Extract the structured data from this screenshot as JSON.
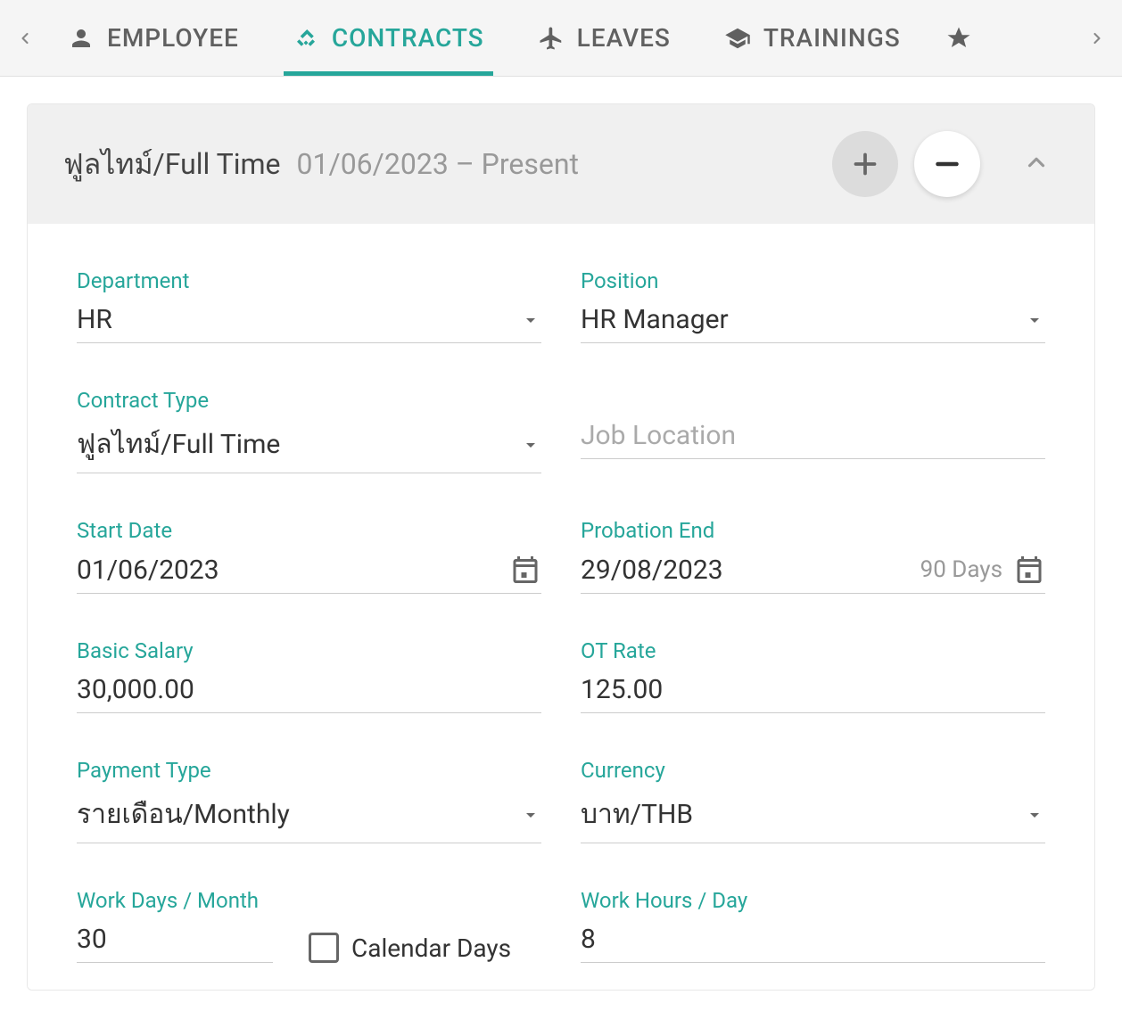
{
  "tabs": {
    "employee": "EMPLOYEE",
    "contracts": "CONTRACTS",
    "leaves": "LEAVES",
    "trainings": "TRAININGS"
  },
  "contract": {
    "title": "ฟูลไทม์/Full Time",
    "date_range": "01/06/2023 – Present",
    "fields": {
      "department": {
        "label": "Department",
        "value": "HR"
      },
      "position": {
        "label": "Position",
        "value": "HR Manager"
      },
      "contract_type": {
        "label": "Contract Type",
        "value": "ฟูลไทม์/Full Time"
      },
      "job_location": {
        "placeholder": "Job Location",
        "value": ""
      },
      "start_date": {
        "label": "Start Date",
        "value": "01/06/2023"
      },
      "probation_end": {
        "label": "Probation End",
        "value": "29/08/2023",
        "suffix": "90 Days"
      },
      "basic_salary": {
        "label": "Basic Salary",
        "value": "30,000.00"
      },
      "ot_rate": {
        "label": "OT Rate",
        "value": "125.00"
      },
      "payment_type": {
        "label": "Payment Type",
        "value": "รายเดือน/Monthly"
      },
      "currency": {
        "label": "Currency",
        "value": "บาท/THB"
      },
      "work_days": {
        "label": "Work Days / Month",
        "value": "30",
        "checkbox_label": "Calendar Days"
      },
      "work_hours": {
        "label": "Work Hours / Day",
        "value": "8"
      }
    }
  }
}
